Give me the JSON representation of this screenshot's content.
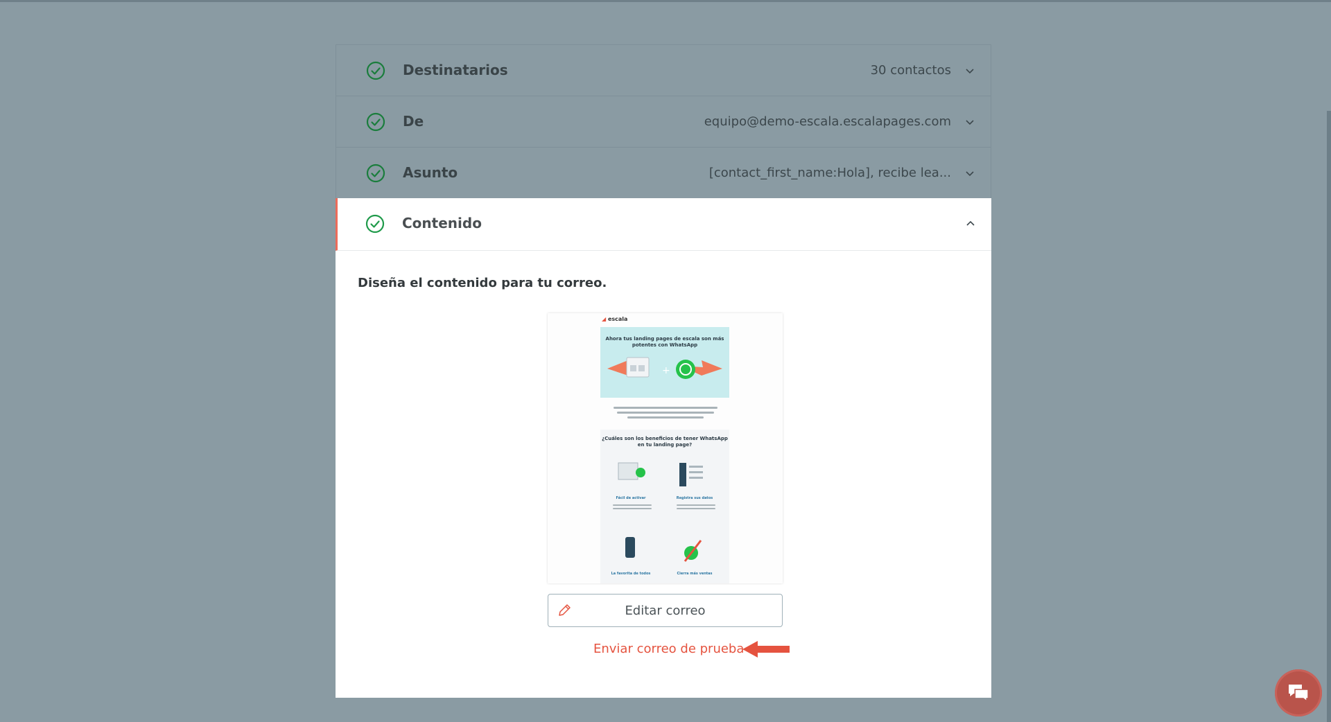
{
  "steps": [
    {
      "label": "Destinatarios",
      "value": "30 contactos",
      "status": "complete"
    },
    {
      "label": "De",
      "value": "equipo@demo-escala.escalapages.com",
      "status": "complete"
    },
    {
      "label": "Asunto",
      "value": "[contact_first_name:Hola], recibe lea...",
      "status": "complete"
    }
  ],
  "active_step": {
    "label": "Contenido",
    "status": "complete",
    "expanded": true
  },
  "content": {
    "heading": "Diseña el contenido para tu correo.",
    "edit_button": "Editar correo",
    "test_link": "Enviar correo de prueba"
  },
  "preview": {
    "logo": "escala",
    "hero_title": "Ahora tus landing pages de escala son más potentes con WhatsApp",
    "question": "¿Cuáles son los beneficios de tener WhatsApp en tu landing page?",
    "benefits": [
      "Fácil de activar",
      "Registra sus datos",
      "La favorita de todos",
      "Cierra más ventas"
    ]
  },
  "colors": {
    "overlay": "#8a9ba3",
    "check_green": "#1f9a4a",
    "accent_red": "#e5533f",
    "chat_bubble": "#b9544b"
  },
  "icons": [
    "check-circle-icon",
    "chevron-down-icon",
    "chevron-up-icon",
    "pencil-icon",
    "arrow-left-icon",
    "chat-icon"
  ]
}
